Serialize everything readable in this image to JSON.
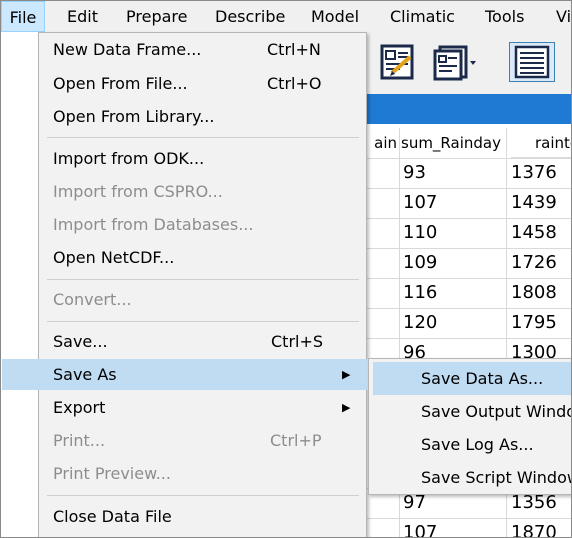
{
  "menubar": {
    "items": [
      "File",
      "Edit",
      "Prepare",
      "Describe",
      "Model",
      "Climatic",
      "Tools",
      "Vi"
    ]
  },
  "grid": {
    "headers": [
      "ain",
      "sum_Rainday",
      "rainto"
    ],
    "rows": [
      [
        "93",
        "1376"
      ],
      [
        "107",
        "1439"
      ],
      [
        "110",
        "1458"
      ],
      [
        "109",
        "1726"
      ],
      [
        "116",
        "1808"
      ],
      [
        "120",
        "1795"
      ],
      [
        "96",
        "1300"
      ],
      [
        "",
        ""
      ],
      [
        "",
        ""
      ],
      [
        "",
        ""
      ],
      [
        "",
        ""
      ],
      [
        "97",
        "1356"
      ],
      [
        "107",
        "1870"
      ]
    ]
  },
  "file_menu": {
    "items": [
      {
        "label": "New Data Frame...",
        "shortcut": "Ctrl+N"
      },
      {
        "label": "Open From File...",
        "shortcut": "Ctrl+O"
      },
      {
        "label": "Open From Library..."
      },
      {
        "label": "Import from ODK..."
      },
      {
        "label": "Import from CSPRO..."
      },
      {
        "label": "Import from Databases..."
      },
      {
        "label": "Open NetCDF..."
      },
      {
        "label": "Convert..."
      },
      {
        "label": "Save...",
        "shortcut": "Ctrl+S"
      },
      {
        "label": "Save As"
      },
      {
        "label": "Export"
      },
      {
        "label": "Print...",
        "shortcut": "Ctrl+P"
      },
      {
        "label": "Print Preview..."
      },
      {
        "label": "Close Data File"
      }
    ],
    "submenu_arrow": "▶"
  },
  "save_as_submenu": {
    "items": [
      "Save Data As...",
      "Save Output Windo",
      "Save Log As...",
      "Save Script Window"
    ]
  }
}
